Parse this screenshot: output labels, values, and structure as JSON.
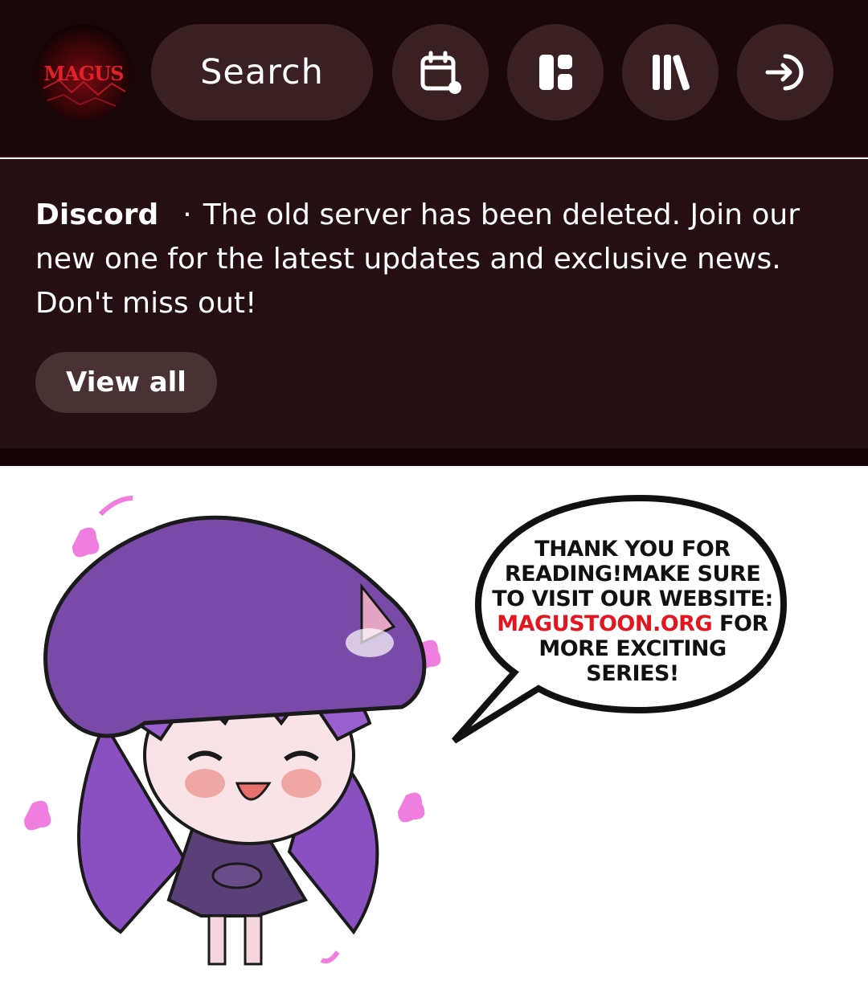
{
  "header": {
    "logo_text": "MAGUS",
    "search_label": "Search",
    "icons": [
      "calendar-icon",
      "dashboard-icon",
      "library-icon",
      "login-icon"
    ]
  },
  "notice": {
    "title": "Discord",
    "separator": "·",
    "message": "The old server has been deleted. Join our new one for the latest updates and exclusive news. Don't miss out!",
    "view_all_label": "View all"
  },
  "banner": {
    "line1": "THANK YOU FOR",
    "line2": "READING!MAKE SURE",
    "line3": "TO VISIT OUR WEBSITE:",
    "link": "MAGUSTOON.ORG",
    "line4_suffix": " FOR",
    "line5": "MORE EXCITING",
    "line6": "SERIES!"
  },
  "colors": {
    "topbar_bg": "#1a0709",
    "notice_bg": "#260f12",
    "button_bg": "#3a2022",
    "link_red": "#e3161f",
    "mascot_purple": "#8a4fc0"
  }
}
